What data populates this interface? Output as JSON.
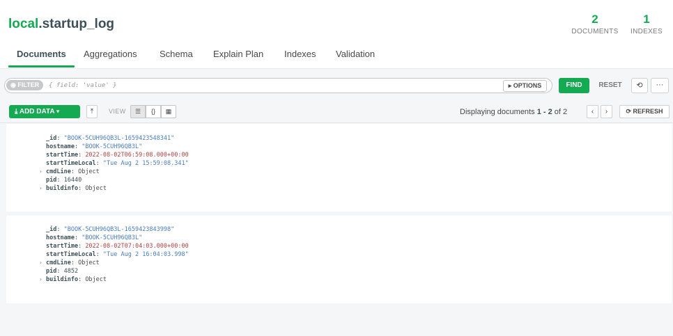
{
  "header": {
    "db": "local",
    "collection": ".startup_log",
    "stats": {
      "documents_count": "2",
      "documents_label": "DOCUMENTS",
      "indexes_count": "1",
      "indexes_label": "INDEXES"
    },
    "tabs": [
      {
        "label": "Documents",
        "active": true
      },
      {
        "label": "Aggregations"
      },
      {
        "label": "Schema"
      },
      {
        "label": "Explain Plan"
      },
      {
        "label": "Indexes"
      },
      {
        "label": "Validation"
      }
    ]
  },
  "querybar": {
    "filter_label": "FILTER",
    "filter_placeholder": "{ field: 'value' }",
    "options_label": "OPTIONS",
    "find_label": "FIND",
    "reset_label": "RESET",
    "history_icon": "⟲",
    "more_icon": "···"
  },
  "toolbar": {
    "add_data_label": "ADD DATA",
    "view_label": "VIEW",
    "display_prefix": "Displaying documents",
    "display_range": "1 - 2",
    "display_of": "of 2",
    "refresh_label": "REFRESH"
  },
  "documents": [
    {
      "_id": "\"BOOK-5CUH96QB3L-1659423548341\"",
      "hostname": "\"BOOK-5CUH96QB3L\"",
      "startTime": "2022-08-02T06:59:08.000+00:00",
      "startTimeLocal": "\"Tue Aug  2 15:59:08.341\"",
      "cmdLine": "Object",
      "pid": "16440",
      "buildinfo": "Object"
    },
    {
      "_id": "\"BOOK-5CUH96QB3L-1659423843998\"",
      "hostname": "\"BOOK-5CUH96QB3L\"",
      "startTime": "2022-08-02T07:04:03.000+00:00",
      "startTimeLocal": "\"Tue Aug  2 16:04:03.998\"",
      "cmdLine": "Object",
      "pid": "4852",
      "buildinfo": "Object"
    }
  ],
  "field_names": {
    "id": "_id",
    "hostname": "hostname",
    "startTime": "startTime",
    "startTimeLocal": "startTimeLocal",
    "cmdLine": "cmdLine",
    "pid": "pid",
    "buildinfo": "buildinfo"
  },
  "colors": {
    "accent": "#13aa52",
    "string": "#4a7cbd",
    "date": "#b04040"
  }
}
